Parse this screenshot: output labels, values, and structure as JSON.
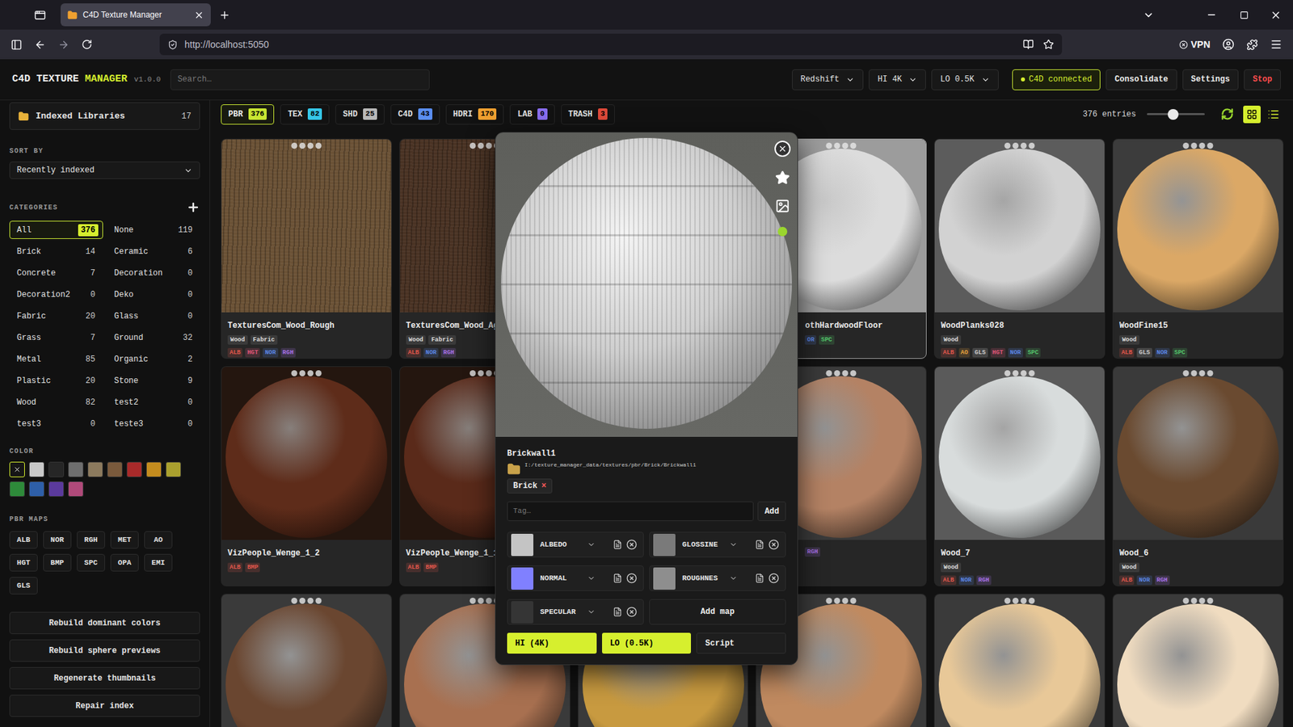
{
  "browser": {
    "tab_title": "C4D Texture Manager",
    "url": "http://localhost:5050",
    "vpn": "VPN"
  },
  "header": {
    "title_prefix": "C4D TEXTURE",
    "title_accent": "MANAGER",
    "version": "v1.0.0",
    "search": {
      "placeholder": "Search…"
    },
    "engine": "Redshift",
    "hi": "HI 4K",
    "lo": "LO 0.5K",
    "status": {
      "label": "C4D connected",
      "connected": true
    },
    "buttons": [
      {
        "label": "Consolidate",
        "kind": "normal"
      },
      {
        "label": "Settings",
        "kind": "normal"
      },
      {
        "label": "Stop",
        "kind": "danger"
      }
    ]
  },
  "sidebar": {
    "libraries": {
      "label": "Indexed Libraries",
      "count": "17"
    },
    "sort_label": "SORT BY",
    "sort_value": "Recently indexed",
    "categories_label": "CATEGORIES",
    "categories": [
      {
        "label": "All",
        "count": "376",
        "selected": true
      },
      {
        "label": "None",
        "count": "119",
        "selected": false
      },
      {
        "label": "Brick",
        "count": "14",
        "selected": false
      },
      {
        "label": "Ceramic",
        "count": "6",
        "selected": false
      },
      {
        "label": "Concrete",
        "count": "7",
        "selected": false
      },
      {
        "label": "Decoration",
        "count": "0",
        "selected": false
      },
      {
        "label": "Decoration2",
        "count": "0",
        "selected": false
      },
      {
        "label": "Deko",
        "count": "0",
        "selected": false
      },
      {
        "label": "Fabric",
        "count": "20",
        "selected": false
      },
      {
        "label": "Glass",
        "count": "0",
        "selected": false
      },
      {
        "label": "Grass",
        "count": "7",
        "selected": false
      },
      {
        "label": "Ground",
        "count": "32",
        "selected": false
      },
      {
        "label": "Metal",
        "count": "85",
        "selected": false
      },
      {
        "label": "Organic",
        "count": "2",
        "selected": false
      },
      {
        "label": "Plastic",
        "count": "20",
        "selected": false
      },
      {
        "label": "Stone",
        "count": "9",
        "selected": false
      },
      {
        "label": "Wood",
        "count": "82",
        "selected": false
      },
      {
        "label": "test2",
        "count": "0",
        "selected": false
      },
      {
        "label": "test3",
        "count": "0",
        "selected": false
      },
      {
        "label": "teste3",
        "count": "0",
        "selected": false
      }
    ],
    "color_label": "COLOR",
    "colors": [
      {
        "color": "#161616",
        "selected": true
      },
      {
        "color": "#c9c9c9",
        "selected": false
      },
      {
        "color": "#262626",
        "selected": false
      },
      {
        "color": "#6e6e6e",
        "selected": false
      },
      {
        "color": "#8c7a5e",
        "selected": false
      },
      {
        "color": "#7a5a3c",
        "selected": false
      },
      {
        "color": "#a82a2a",
        "selected": false
      },
      {
        "color": "#c48c1e",
        "selected": false
      },
      {
        "color": "#aaa02e",
        "selected": false
      },
      {
        "color": "#2e8a3a",
        "selected": false
      },
      {
        "color": "#2e5fa8",
        "selected": false
      },
      {
        "color": "#5b3a9c",
        "selected": false
      },
      {
        "color": "#b04a7a",
        "selected": false
      }
    ],
    "maps_label": "PBR MAPS",
    "maps": [
      "ALB",
      "NOR",
      "RGH",
      "MET",
      "AO",
      "HGT",
      "BMP",
      "SPC",
      "OPA",
      "EMI",
      "GLS"
    ],
    "actions": [
      "Rebuild dominant colors",
      "Rebuild sphere previews",
      "Regenerate thumbnails",
      "Repair index"
    ]
  },
  "tabs": [
    {
      "label": "PBR",
      "count": "376",
      "color": "#c8e632",
      "selected": true
    },
    {
      "label": "TEX",
      "count": "82",
      "color": "#35c7e8",
      "selected": false
    },
    {
      "label": "SHD",
      "count": "25",
      "color": "#b8b8b8",
      "selected": false
    },
    {
      "label": "C4D",
      "count": "43",
      "color": "#5a8ef0",
      "selected": false
    },
    {
      "label": "HDRI",
      "count": "170",
      "color": "#f0a030",
      "selected": false
    },
    {
      "label": "LAB",
      "count": "0",
      "color": "#8a6ef0",
      "selected": false
    },
    {
      "label": "TRASH",
      "count": "3",
      "color": "#e04a3a",
      "selected": false
    }
  ],
  "toolbar": {
    "entries": "376 entries",
    "size_level": 0.45,
    "views": [
      {
        "kind": "grid",
        "selected": true
      },
      {
        "kind": "list",
        "selected": false
      }
    ]
  },
  "cards": [
    {
      "kind": "flat",
      "name": "TexturesCom_Wood_Rough",
      "tags": [
        "Wood",
        "Fabric"
      ],
      "maps": [
        {
          "label": "ALB",
          "color": "#e2574c"
        },
        {
          "label": "HGT",
          "color": "#e0577a"
        },
        {
          "label": "NOR",
          "color": "#5b86e5"
        },
        {
          "label": "RGH",
          "color": "#a872e8"
        }
      ],
      "color": "#6b5236",
      "bg": "#3a3026",
      "selected": false
    },
    {
      "kind": "flat",
      "name": "TexturesCom_Wood_Ag",
      "tags": [
        "Wood",
        "Fabric"
      ],
      "maps": [
        {
          "label": "ALB",
          "color": "#e2574c"
        },
        {
          "label": "NOR",
          "color": "#5b86e5"
        },
        {
          "label": "RGH",
          "color": "#a872e8"
        }
      ],
      "color": "#4a3324",
      "bg": "#2e2018",
      "selected": false
    },
    {
      "kind": "sphere",
      "name": "",
      "tags": [],
      "maps": [],
      "color": "#8a8a8a",
      "bg": "#3a3a3a",
      "selected": false
    },
    {
      "kind": "sphere",
      "name": "othHardwoodFloor",
      "tags": [],
      "maps": [
        {
          "label": "OR",
          "color": "#5b86e5"
        },
        {
          "label": "SPC",
          "color": "#54c56c"
        }
      ],
      "color": "#dcdcdc",
      "bg": "#9c9c9c",
      "selected": true
    },
    {
      "kind": "sphere",
      "name": "WoodPlanks028",
      "tags": [
        "Wood"
      ],
      "maps": [
        {
          "label": "ALB",
          "color": "#e2574c"
        },
        {
          "label": "AO",
          "color": "#e8a33d"
        },
        {
          "label": "GLS",
          "color": "#d0d0d0"
        },
        {
          "label": "HGT",
          "color": "#e0577a"
        },
        {
          "label": "NOR",
          "color": "#5b86e5"
        },
        {
          "label": "SPC",
          "color": "#54c56c"
        }
      ],
      "color": "#d2d2d2",
      "bg": "#5c5c5c",
      "selected": false
    },
    {
      "kind": "sphere",
      "name": "WoodFine15",
      "tags": [
        "Wood"
      ],
      "maps": [
        {
          "label": "ALB",
          "color": "#e2574c"
        },
        {
          "label": "GLS",
          "color": "#d0d0d0"
        },
        {
          "label": "NOR",
          "color": "#5b86e5"
        },
        {
          "label": "SPC",
          "color": "#54c56c"
        }
      ],
      "color": "#dba866",
      "bg": "#3c3c3c",
      "selected": false
    },
    {
      "kind": "sphere",
      "name": "VizPeople_Wenge_1_2",
      "tags": [],
      "maps": [
        {
          "label": "ALB",
          "color": "#e2574c"
        },
        {
          "label": "BMP",
          "color": "#e2574c"
        }
      ],
      "color": "#5e2c1a",
      "bg": "#24160f",
      "selected": false
    },
    {
      "kind": "sphere",
      "name": "VizPeople_Wenge_1_1",
      "tags": [],
      "maps": [
        {
          "label": "ALB",
          "color": "#e2574c"
        },
        {
          "label": "BMP",
          "color": "#e2574c"
        }
      ],
      "color": "#5a2a1a",
      "bg": "#24160f",
      "selected": false
    },
    {
      "kind": "sphere",
      "name": "",
      "tags": [],
      "maps": [],
      "color": "#8a6a3a",
      "bg": "#3a3a3a",
      "selected": false
    },
    {
      "kind": "sphere",
      "name": "",
      "tags": [],
      "maps": [
        {
          "label": "RGH",
          "color": "#a872e8"
        }
      ],
      "color": "#b48264",
      "bg": "#3a3a3a",
      "selected": false
    },
    {
      "kind": "sphere",
      "name": "Wood_7",
      "tags": [
        "Wood"
      ],
      "maps": [
        {
          "label": "ALB",
          "color": "#e2574c"
        },
        {
          "label": "NOR",
          "color": "#5b86e5"
        },
        {
          "label": "RGH",
          "color": "#a872e8"
        }
      ],
      "color": "#d8dcdc",
      "bg": "#5a5a5a",
      "selected": false
    },
    {
      "kind": "sphere",
      "name": "Wood_6",
      "tags": [
        "Wood"
      ],
      "maps": [
        {
          "label": "ALB",
          "color": "#e2574c"
        },
        {
          "label": "NOR",
          "color": "#5b86e5"
        },
        {
          "label": "RGH",
          "color": "#a872e8"
        }
      ],
      "color": "#6a4a30",
      "bg": "#3a3a3a",
      "selected": false
    },
    {
      "kind": "sphere",
      "name": "",
      "tags": [],
      "maps": [],
      "color": "#6a4630",
      "bg": "#3a3a3a",
      "selected": false
    },
    {
      "kind": "sphere",
      "name": "",
      "tags": [],
      "maps": [],
      "color": "#a87050",
      "bg": "#3a3a3a",
      "selected": false
    },
    {
      "kind": "sphere",
      "name": "",
      "tags": [],
      "maps": [],
      "color": "#c89a40",
      "bg": "#3a3a3a",
      "selected": false
    },
    {
      "kind": "sphere",
      "name": "",
      "tags": [],
      "maps": [],
      "color": "#c08a60",
      "bg": "#3a3a3a",
      "selected": false
    },
    {
      "kind": "sphere",
      "name": "",
      "tags": [],
      "maps": [],
      "color": "#e8c898",
      "bg": "#3a3a3a",
      "selected": false
    },
    {
      "kind": "sphere",
      "name": "",
      "tags": [],
      "maps": [],
      "color": "#f0dcc0",
      "bg": "#3a3a3a",
      "selected": false
    }
  ],
  "detail": {
    "name": "Brickwall1",
    "path": "I:/texture_manager_data/textures/pbr/Brick/Brickwall1",
    "favorite": false,
    "tags": [
      {
        "label": "Brick",
        "remove": "×"
      }
    ],
    "tag_input": {
      "placeholder": "Tag…"
    },
    "add": "Add",
    "maps": [
      {
        "label": "ALBEDO",
        "color": "#c4c4c4"
      },
      {
        "label": "GLOSSINE",
        "color": "#7a7a7a"
      },
      {
        "label": "NORMAL",
        "color": "#8080ff"
      },
      {
        "label": "ROUGHNES",
        "color": "#8e8e8e"
      },
      {
        "label": "SPECULAR",
        "color": "#353535"
      }
    ],
    "add_map": "Add map",
    "actions": [
      {
        "label": "HI (4K)",
        "active": true
      },
      {
        "label": "LO (0.5K)",
        "active": true
      },
      {
        "label": "Script",
        "active": false
      }
    ]
  }
}
